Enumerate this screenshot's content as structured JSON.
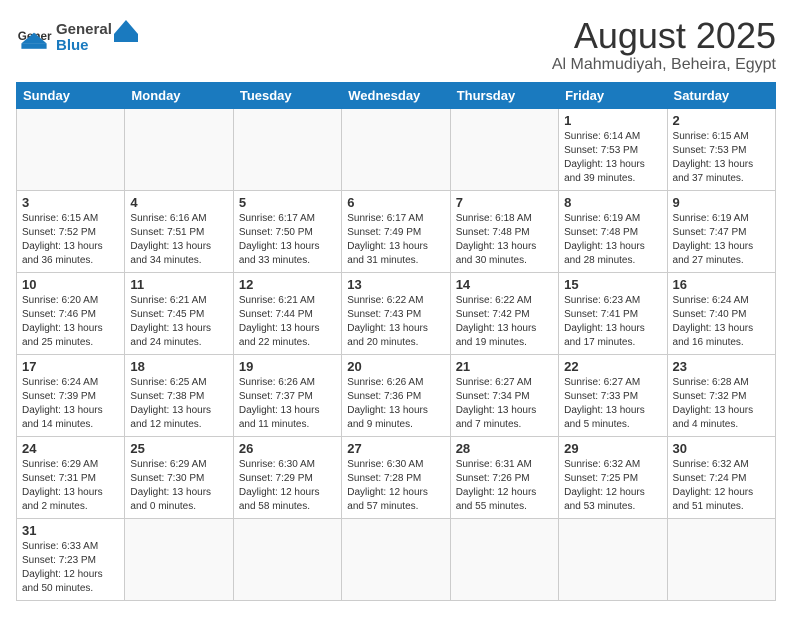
{
  "header": {
    "logo_general": "General",
    "logo_blue": "Blue",
    "month_title": "August 2025",
    "location": "Al Mahmudiyah, Beheira, Egypt"
  },
  "weekdays": [
    "Sunday",
    "Monday",
    "Tuesday",
    "Wednesday",
    "Thursday",
    "Friday",
    "Saturday"
  ],
  "days": [
    {
      "num": "",
      "info": ""
    },
    {
      "num": "",
      "info": ""
    },
    {
      "num": "",
      "info": ""
    },
    {
      "num": "",
      "info": ""
    },
    {
      "num": "",
      "info": ""
    },
    {
      "num": "1",
      "info": "Sunrise: 6:14 AM\nSunset: 7:53 PM\nDaylight: 13 hours and 39 minutes."
    },
    {
      "num": "2",
      "info": "Sunrise: 6:15 AM\nSunset: 7:53 PM\nDaylight: 13 hours and 37 minutes."
    },
    {
      "num": "3",
      "info": "Sunrise: 6:15 AM\nSunset: 7:52 PM\nDaylight: 13 hours and 36 minutes."
    },
    {
      "num": "4",
      "info": "Sunrise: 6:16 AM\nSunset: 7:51 PM\nDaylight: 13 hours and 34 minutes."
    },
    {
      "num": "5",
      "info": "Sunrise: 6:17 AM\nSunset: 7:50 PM\nDaylight: 13 hours and 33 minutes."
    },
    {
      "num": "6",
      "info": "Sunrise: 6:17 AM\nSunset: 7:49 PM\nDaylight: 13 hours and 31 minutes."
    },
    {
      "num": "7",
      "info": "Sunrise: 6:18 AM\nSunset: 7:48 PM\nDaylight: 13 hours and 30 minutes."
    },
    {
      "num": "8",
      "info": "Sunrise: 6:19 AM\nSunset: 7:48 PM\nDaylight: 13 hours and 28 minutes."
    },
    {
      "num": "9",
      "info": "Sunrise: 6:19 AM\nSunset: 7:47 PM\nDaylight: 13 hours and 27 minutes."
    },
    {
      "num": "10",
      "info": "Sunrise: 6:20 AM\nSunset: 7:46 PM\nDaylight: 13 hours and 25 minutes."
    },
    {
      "num": "11",
      "info": "Sunrise: 6:21 AM\nSunset: 7:45 PM\nDaylight: 13 hours and 24 minutes."
    },
    {
      "num": "12",
      "info": "Sunrise: 6:21 AM\nSunset: 7:44 PM\nDaylight: 13 hours and 22 minutes."
    },
    {
      "num": "13",
      "info": "Sunrise: 6:22 AM\nSunset: 7:43 PM\nDaylight: 13 hours and 20 minutes."
    },
    {
      "num": "14",
      "info": "Sunrise: 6:22 AM\nSunset: 7:42 PM\nDaylight: 13 hours and 19 minutes."
    },
    {
      "num": "15",
      "info": "Sunrise: 6:23 AM\nSunset: 7:41 PM\nDaylight: 13 hours and 17 minutes."
    },
    {
      "num": "16",
      "info": "Sunrise: 6:24 AM\nSunset: 7:40 PM\nDaylight: 13 hours and 16 minutes."
    },
    {
      "num": "17",
      "info": "Sunrise: 6:24 AM\nSunset: 7:39 PM\nDaylight: 13 hours and 14 minutes."
    },
    {
      "num": "18",
      "info": "Sunrise: 6:25 AM\nSunset: 7:38 PM\nDaylight: 13 hours and 12 minutes."
    },
    {
      "num": "19",
      "info": "Sunrise: 6:26 AM\nSunset: 7:37 PM\nDaylight: 13 hours and 11 minutes."
    },
    {
      "num": "20",
      "info": "Sunrise: 6:26 AM\nSunset: 7:36 PM\nDaylight: 13 hours and 9 minutes."
    },
    {
      "num": "21",
      "info": "Sunrise: 6:27 AM\nSunset: 7:34 PM\nDaylight: 13 hours and 7 minutes."
    },
    {
      "num": "22",
      "info": "Sunrise: 6:27 AM\nSunset: 7:33 PM\nDaylight: 13 hours and 5 minutes."
    },
    {
      "num": "23",
      "info": "Sunrise: 6:28 AM\nSunset: 7:32 PM\nDaylight: 13 hours and 4 minutes."
    },
    {
      "num": "24",
      "info": "Sunrise: 6:29 AM\nSunset: 7:31 PM\nDaylight: 13 hours and 2 minutes."
    },
    {
      "num": "25",
      "info": "Sunrise: 6:29 AM\nSunset: 7:30 PM\nDaylight: 13 hours and 0 minutes."
    },
    {
      "num": "26",
      "info": "Sunrise: 6:30 AM\nSunset: 7:29 PM\nDaylight: 12 hours and 58 minutes."
    },
    {
      "num": "27",
      "info": "Sunrise: 6:30 AM\nSunset: 7:28 PM\nDaylight: 12 hours and 57 minutes."
    },
    {
      "num": "28",
      "info": "Sunrise: 6:31 AM\nSunset: 7:26 PM\nDaylight: 12 hours and 55 minutes."
    },
    {
      "num": "29",
      "info": "Sunrise: 6:32 AM\nSunset: 7:25 PM\nDaylight: 12 hours and 53 minutes."
    },
    {
      "num": "30",
      "info": "Sunrise: 6:32 AM\nSunset: 7:24 PM\nDaylight: 12 hours and 51 minutes."
    },
    {
      "num": "31",
      "info": "Sunrise: 6:33 AM\nSunset: 7:23 PM\nDaylight: 12 hours and 50 minutes."
    }
  ]
}
